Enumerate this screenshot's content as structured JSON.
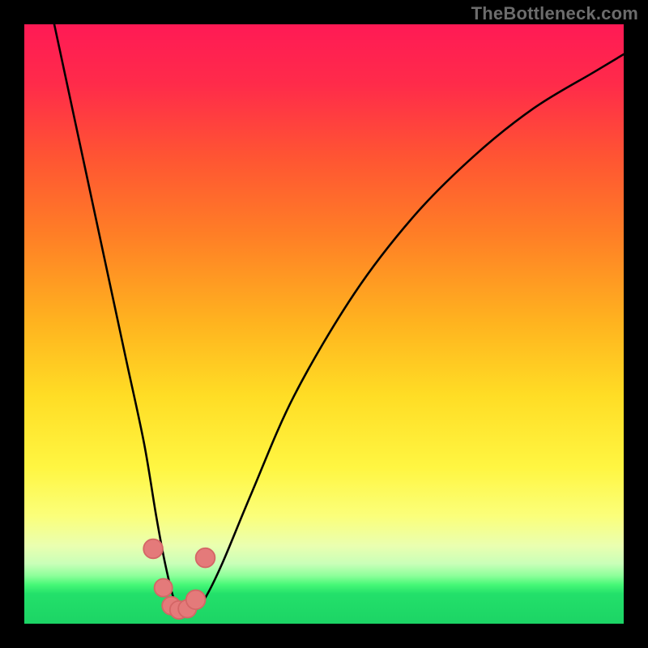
{
  "watermark": "TheBottleneck.com",
  "colors": {
    "bg": "#000000",
    "curve": "#000000",
    "marker_fill": "#e47a7a",
    "marker_stroke": "#d46666",
    "gradient_stops": [
      {
        "offset": "0%",
        "color": "#ff1a55"
      },
      {
        "offset": "10%",
        "color": "#ff2b4a"
      },
      {
        "offset": "22%",
        "color": "#ff5433"
      },
      {
        "offset": "35%",
        "color": "#ff7e26"
      },
      {
        "offset": "50%",
        "color": "#ffb41f"
      },
      {
        "offset": "62%",
        "color": "#ffdd25"
      },
      {
        "offset": "74%",
        "color": "#fff642"
      },
      {
        "offset": "82%",
        "color": "#fbff7a"
      },
      {
        "offset": "87%",
        "color": "#eaffb0"
      },
      {
        "offset": "90%",
        "color": "#c9ffb8"
      },
      {
        "offset": "92%",
        "color": "#8dff9a"
      },
      {
        "offset": "93.5%",
        "color": "#46f877"
      },
      {
        "offset": "95%",
        "color": "#23e06a"
      },
      {
        "offset": "100%",
        "color": "#1cd465"
      }
    ]
  },
  "chart_data": {
    "type": "line",
    "title": "",
    "xlabel": "",
    "ylabel": "",
    "xlim": [
      0,
      100
    ],
    "ylim": [
      0,
      100
    ],
    "series": [
      {
        "name": "bottleneck-curve",
        "x": [
          5,
          8,
          11,
          14,
          17,
          20,
          22,
          23.5,
          25,
          26.5,
          28,
          30,
          33,
          38,
          45,
          55,
          65,
          75,
          85,
          95,
          100
        ],
        "y": [
          100,
          86,
          72,
          58,
          44,
          30,
          18,
          10,
          4,
          2,
          2,
          4,
          10,
          22,
          38,
          55,
          68,
          78,
          86,
          92,
          95
        ]
      }
    ],
    "markers": {
      "name": "highlight-points",
      "x": [
        21.5,
        23.2,
        24.5,
        25.8,
        27.2,
        28.6,
        30.2
      ],
      "y": [
        12.5,
        6.0,
        3.0,
        2.3,
        2.5,
        4.0,
        11.0
      ],
      "r": [
        1.6,
        1.5,
        1.5,
        1.5,
        1.5,
        1.6,
        1.6
      ]
    }
  }
}
